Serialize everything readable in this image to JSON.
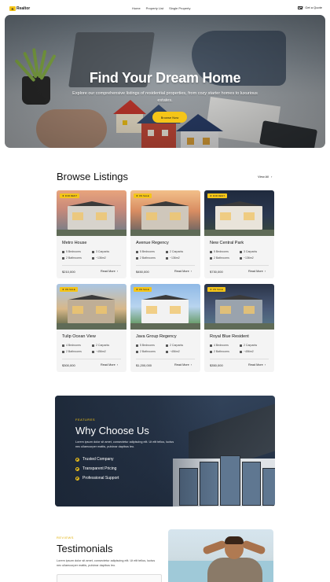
{
  "nav": {
    "logo_text": "Realtor",
    "links": [
      "Home",
      "Property List",
      "Single Property"
    ],
    "cta": "Get a Quote"
  },
  "hero": {
    "title": "Find Your Dream Home",
    "subtitle": "Explore our comprehensive listings of residential properties, from cozy starter homes to luxurious estates.",
    "button": "Browse Now"
  },
  "listings": {
    "title": "Browse Listings",
    "view_all": "View All",
    "cards": [
      {
        "badge": "FOR RENT",
        "name": "Metro House",
        "beds": "5 Bedrooms",
        "parking": "3 Carparks",
        "baths": "2 Bathrooms",
        "area": "~136m2",
        "price": "$210,000",
        "more": "Read More"
      },
      {
        "badge": "ON SALE",
        "name": "Avenue Regency",
        "beds": "5 Bedrooms",
        "parking": "2 Carparks",
        "baths": "2 Bathrooms",
        "area": "~136m2",
        "price": "$450,000",
        "more": "Read More"
      },
      {
        "badge": "FOR RENT",
        "name": "New Central Park",
        "beds": "5 Bedrooms",
        "parking": "3 Carparks",
        "baths": "2 Bathrooms",
        "area": "~136m2",
        "price": "$730,000",
        "more": "Read More"
      },
      {
        "badge": "ON SALE",
        "name": "Tulip Ocean View",
        "beds": "4 Bedrooms",
        "parking": "2 Carparks",
        "baths": "2 Bathrooms",
        "area": "~456m2",
        "price": "$300,000",
        "more": "Read More"
      },
      {
        "badge": "ON SALE",
        "name": "Java Group Regency",
        "beds": "5 Bedrooms",
        "parking": "2 Carparks",
        "baths": "2 Bathrooms",
        "area": "~456m2",
        "price": "$1,200,000",
        "more": "Read More"
      },
      {
        "badge": "ON SALE",
        "name": "Royal Blue Resident",
        "beds": "4 Bedrooms",
        "parking": "2 Carparks",
        "baths": "2 Bathrooms",
        "area": "~456m2",
        "price": "$350,000",
        "more": "Read More"
      }
    ]
  },
  "why": {
    "eyebrow": "FEATURES",
    "title": "Why Choose Us",
    "text": "Lorem ipsum dolor sit amet, consectetur adipiscing elit. Ut elit tellus, luctus nec ullamcorper mattis, pulvinar dapibus leo.",
    "items": [
      "Trusted Company",
      "Transparent Pricing",
      "Professional Support"
    ]
  },
  "testimonials": {
    "eyebrow": "REVIEWS",
    "title": "Testimonials",
    "text": "Lorem ipsum dolor sit amet, consectetur adipiscing elit. Ut elit tellus, luctus nec ullamcorper mattis, pulvinar dapibus leo."
  },
  "colors": {
    "accent": "#f5c518",
    "dark": "#1a1a1a"
  }
}
